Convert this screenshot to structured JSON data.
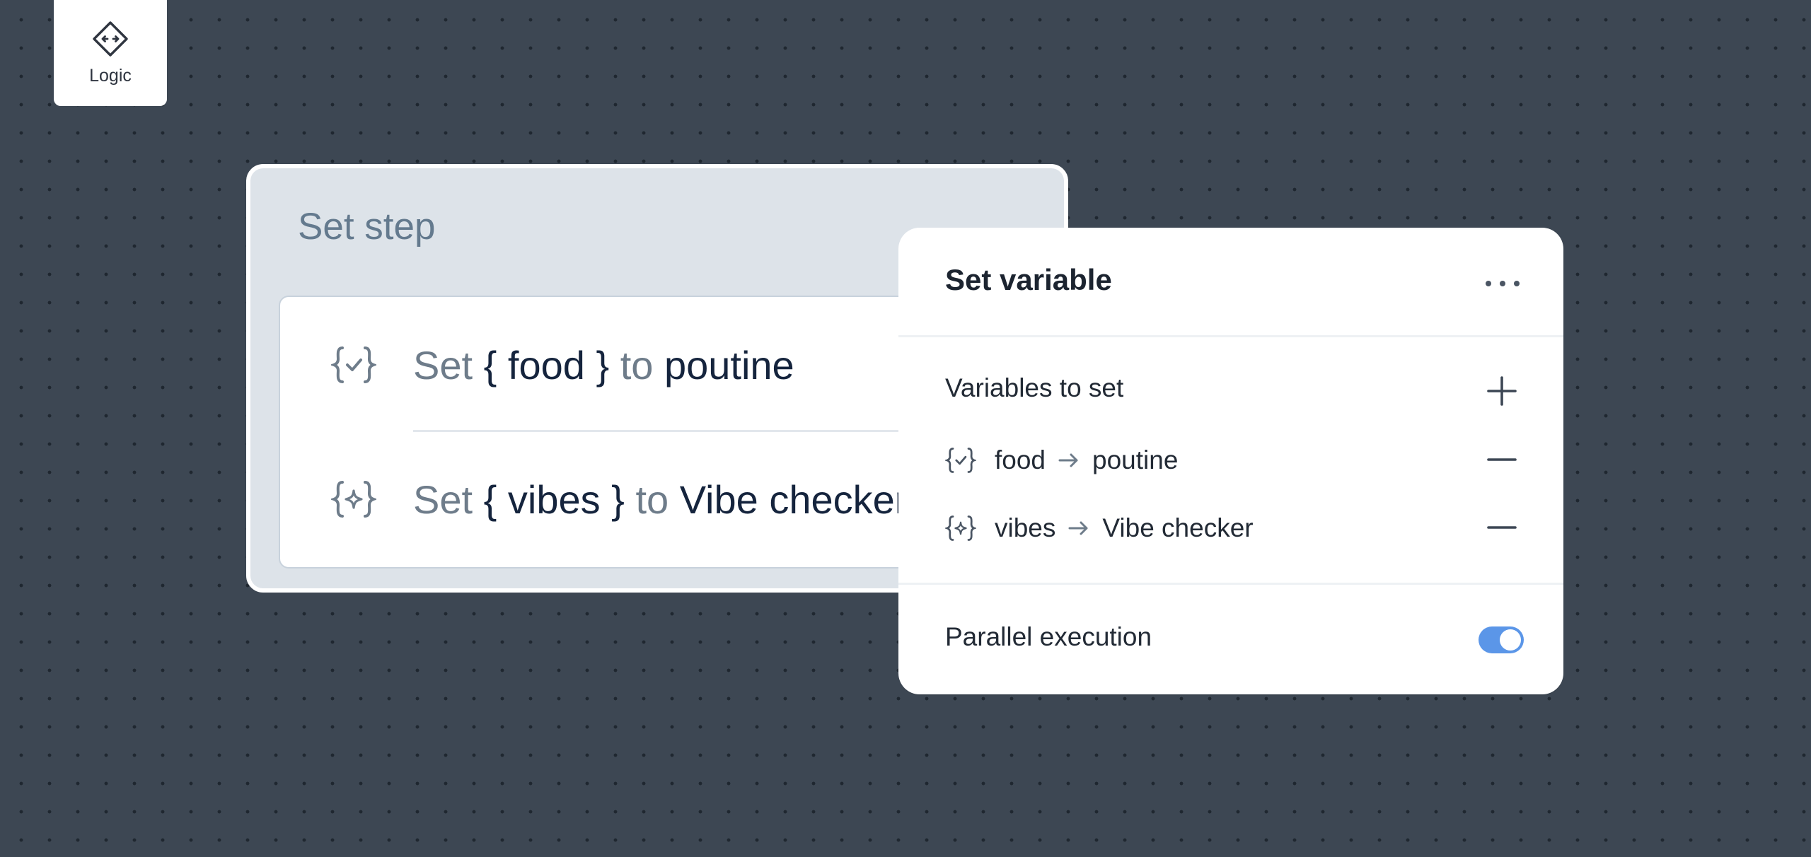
{
  "colors": {
    "canvas_bg": "#3d4753",
    "accent": "#5b96e8",
    "step_card_bg": "#dde3e9"
  },
  "logic_block": {
    "label": "Logic",
    "icon": "diamond-arrows-icon"
  },
  "set_step": {
    "title": "Set step",
    "rows": [
      {
        "icon": "braces-check-icon",
        "verb": "Set",
        "variable": "{ food }",
        "connector": "to",
        "value": "poutine"
      },
      {
        "icon": "braces-sparkle-icon",
        "verb": "Set",
        "variable": "{ vibes }",
        "connector": "to",
        "value": "Vibe checker"
      }
    ]
  },
  "panel": {
    "title": "Set variable",
    "more_icon": "more-horizontal-icon",
    "variables_label": "Variables to set",
    "add_icon": "plus-icon",
    "variables": [
      {
        "icon": "braces-check-icon",
        "name": "food",
        "value": "poutine",
        "remove_icon": "minus-icon"
      },
      {
        "icon": "braces-sparkle-icon",
        "name": "vibes",
        "value": "Vibe checker",
        "remove_icon": "minus-icon"
      }
    ],
    "parallel_label": "Parallel execution",
    "parallel_enabled": true
  }
}
